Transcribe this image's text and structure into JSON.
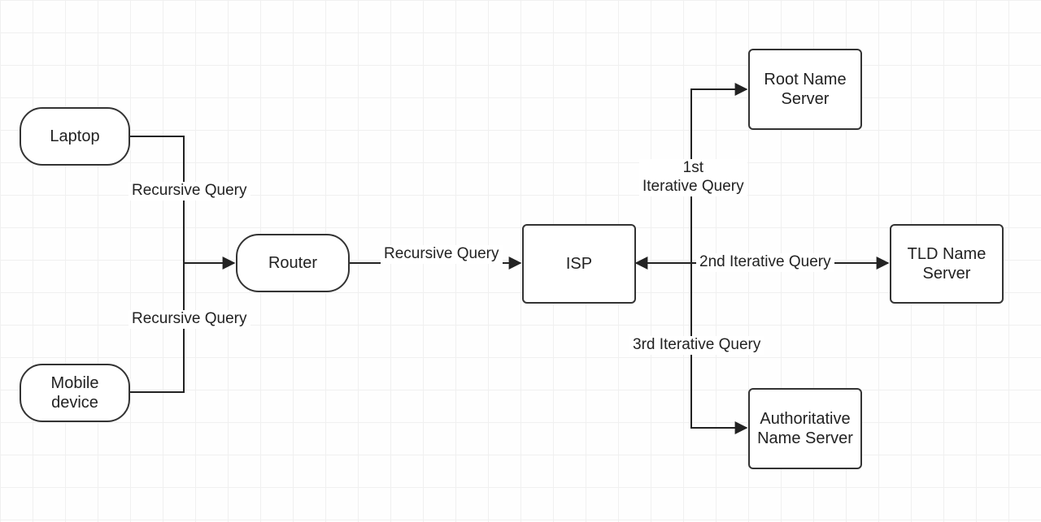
{
  "nodes": {
    "laptop": "Laptop",
    "mobile": "Mobile device",
    "router": "Router",
    "isp": "ISP",
    "root": "Root Name Server",
    "tld": "TLD Name Server",
    "auth": "Authoritative Name Server"
  },
  "edges": {
    "laptop_router": "Recursive Query",
    "mobile_router": "Recursive Query",
    "router_isp": "Recursive Query",
    "isp_root": "1st\nIterative Query",
    "isp_tld": "2nd Iterative Query",
    "isp_auth": "3rd Iterative Query"
  }
}
